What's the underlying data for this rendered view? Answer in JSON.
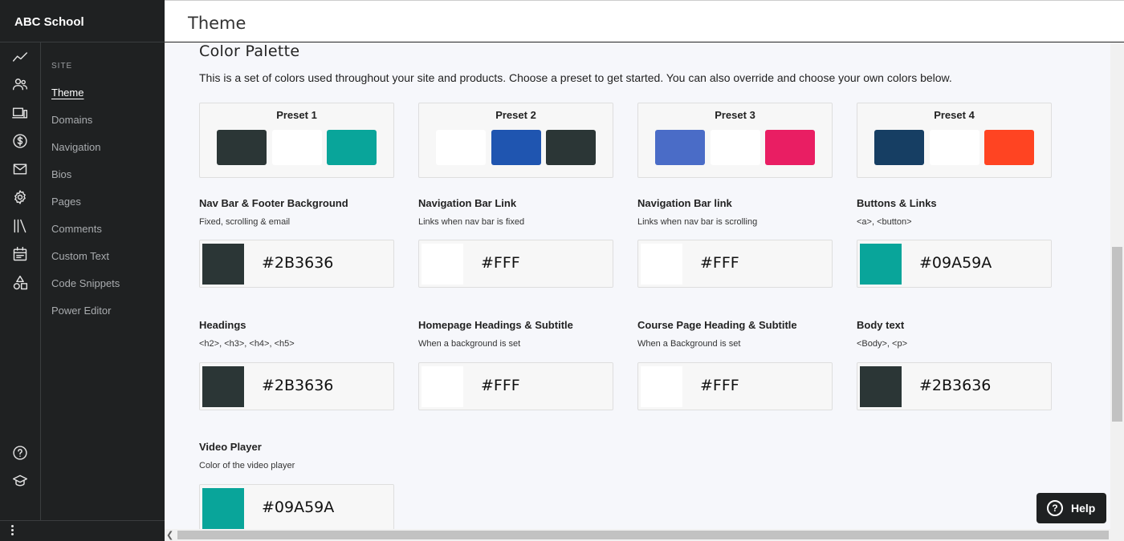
{
  "app": {
    "brand": "ABC School",
    "page_title": "Theme"
  },
  "sidebar": {
    "section_label": "SITE",
    "items": [
      {
        "label": "Theme",
        "active": true
      },
      {
        "label": "Domains"
      },
      {
        "label": "Navigation"
      },
      {
        "label": "Bios"
      },
      {
        "label": "Pages"
      },
      {
        "label": "Comments"
      },
      {
        "label": "Custom Text"
      },
      {
        "label": "Code Snippets"
      },
      {
        "label": "Power Editor"
      }
    ],
    "rail_icons": [
      "analytics-icon",
      "users-icon",
      "devices-icon",
      "dollar-icon",
      "mail-icon",
      "gear-icon",
      "library-icon",
      "calendar-icon",
      "shapes-icon",
      "question-icon",
      "graduation-cap-icon"
    ]
  },
  "palette": {
    "title": "Color Palette",
    "description": "This is a set of colors used throughout your site and products. Choose a preset to get started. You can also override and choose your own colors below.",
    "presets": [
      {
        "label": "Preset 1",
        "colors": [
          "#2B3636",
          "#FFFFFF",
          "#09A59A"
        ]
      },
      {
        "label": "Preset 2",
        "colors": [
          "#FFFFFF",
          "#1F55B0",
          "#2B3636"
        ]
      },
      {
        "label": "Preset 3",
        "colors": [
          "#4A6CC7",
          "#FFFFFF",
          "#E91E63"
        ]
      },
      {
        "label": "Preset 4",
        "colors": [
          "#163E63",
          "#FFFFFF",
          "#FF4422"
        ]
      }
    ],
    "fields": [
      {
        "title": "Nav Bar & Footer Background",
        "subtitle": "Fixed, scrolling & email",
        "value": "#2B3636",
        "color": "#2B3636"
      },
      {
        "title": "Navigation Bar Link",
        "subtitle": "Links when nav bar is fixed",
        "value": "#FFF",
        "color": "#FFFFFF"
      },
      {
        "title": "Navigation Bar link",
        "subtitle": "Links when nav bar is scrolling",
        "value": "#FFF",
        "color": "#FFFFFF"
      },
      {
        "title": "Buttons & Links",
        "subtitle": "<a>, <button>",
        "value": "#09A59A",
        "color": "#09A59A"
      },
      {
        "title": "Headings",
        "subtitle": "<h2>, <h3>, <h4>, <h5>",
        "value": "#2B3636",
        "color": "#2B3636"
      },
      {
        "title": "Homepage Headings & Subtitle",
        "subtitle": "When a background is set",
        "value": "#FFF",
        "color": "#FFFFFF"
      },
      {
        "title": "Course Page Heading & Subtitle",
        "subtitle": "When a Background is set",
        "value": "#FFF",
        "color": "#FFFFFF"
      },
      {
        "title": "Body text",
        "subtitle": "<Body>, <p>",
        "value": "#2B3636",
        "color": "#2B3636"
      },
      {
        "title": "Video Player",
        "subtitle": "Color of the video player",
        "value": "#09A59A",
        "color": "#09A59A"
      }
    ]
  },
  "help": {
    "label": "Help"
  },
  "colors": {
    "sidebar_bg": "#1F2122",
    "page_bg": "#F6F7FB",
    "accent": "#09A59A"
  }
}
